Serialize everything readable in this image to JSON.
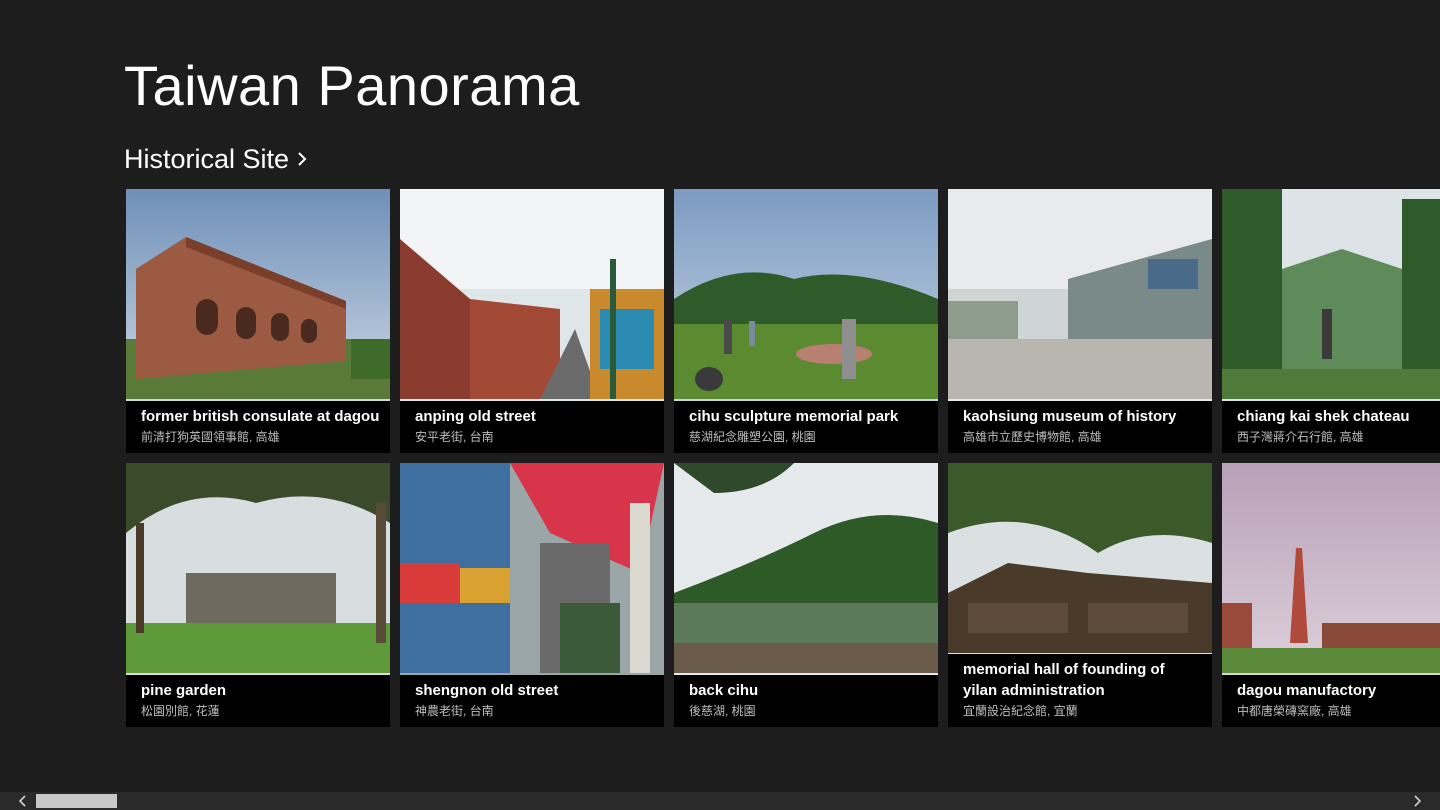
{
  "app": {
    "title": "Taiwan Panorama"
  },
  "section": {
    "label": "Historical Site"
  },
  "tiles": [
    {
      "title": "former british consulate at dagou",
      "subtitle": "前清打狗英國領事館, 高雄",
      "scene": "red-brick-building"
    },
    {
      "title": "anping old street",
      "subtitle": "安平老街, 台南",
      "scene": "old-street-alley"
    },
    {
      "title": "cihu sculpture memorial park",
      "subtitle": "慈湖紀念雕塑公園, 桃園",
      "scene": "park-statues"
    },
    {
      "title": "kaohsiung museum of history",
      "subtitle": "高雄市立歷史博物館, 高雄",
      "scene": "museum-plaza"
    },
    {
      "title": "chiang kai shek chateau",
      "subtitle": "西子灣蔣介石行館, 高雄",
      "scene": "green-chateau"
    },
    {
      "title": "pine garden",
      "subtitle": "松園別館, 花蓮",
      "scene": "pine-garden-lawn"
    },
    {
      "title": "shengnon old street",
      "subtitle": "神農老街, 台南",
      "scene": "lantern-street"
    },
    {
      "title": "back cihu",
      "subtitle": "後慈湖, 桃園",
      "scene": "mountain-lake"
    },
    {
      "title": "memorial hall of founding of yilan administration",
      "subtitle": "宜蘭設治紀念館, 宜蘭",
      "scene": "wooden-house"
    },
    {
      "title": "dagou manufactory",
      "subtitle": "中都唐榮磚窯廠, 高雄",
      "scene": "brick-chimney"
    }
  ],
  "scrollbar": {
    "position": 0.0
  }
}
